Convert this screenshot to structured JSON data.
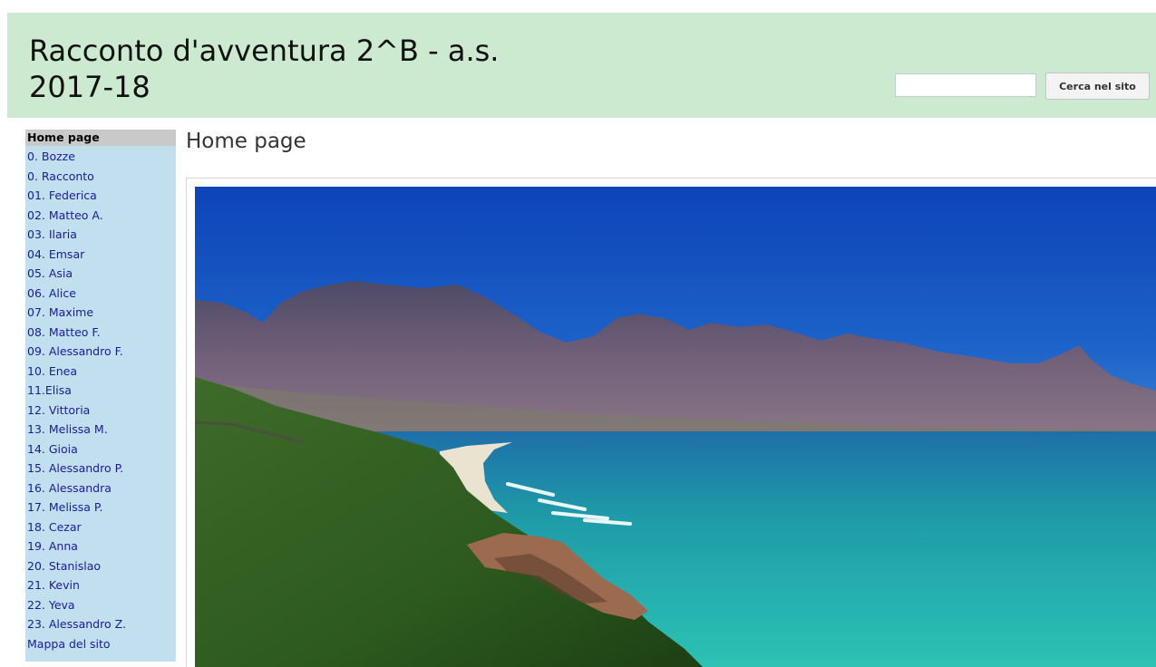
{
  "header": {
    "title": "Racconto d'avventura 2^B - a.s. 2017-18",
    "search_placeholder": "",
    "search_button_label": "Cerca nel sito"
  },
  "sidebar": {
    "items": [
      {
        "label": "Home page",
        "active": true
      },
      {
        "label": "0. Bozze"
      },
      {
        "label": "0. Racconto"
      },
      {
        "label": "01. Federica"
      },
      {
        "label": "02. Matteo A."
      },
      {
        "label": "03. Ilaria"
      },
      {
        "label": "04. Emsar"
      },
      {
        "label": "05. Asia"
      },
      {
        "label": "06. Alice"
      },
      {
        "label": "07. Maxime"
      },
      {
        "label": "08. Matteo F."
      },
      {
        "label": "09. Alessandro F."
      },
      {
        "label": "10. Enea"
      },
      {
        "label": "11.Elisa"
      },
      {
        "label": "12. Vittoria"
      },
      {
        "label": "13. Melissa M."
      },
      {
        "label": "14. Gioia"
      },
      {
        "label": "15. Alessandro P."
      },
      {
        "label": "16. Alessandra"
      },
      {
        "label": "17. Melissa P."
      },
      {
        "label": "18. Cezar"
      },
      {
        "label": "19. Anna"
      },
      {
        "label": "20. Stanislao"
      },
      {
        "label": "21. Kevin"
      },
      {
        "label": "22. Yeva"
      },
      {
        "label": "23. Alessandro Z."
      },
      {
        "label": "Mappa del sito"
      }
    ]
  },
  "main": {
    "page_title": "Home page"
  },
  "colors": {
    "header_bg": "#cceacf",
    "sidebar_bg": "#c2dff0",
    "link": "#1a1a99",
    "sky": "#1e5bbf",
    "sea": "#22b3b0"
  }
}
